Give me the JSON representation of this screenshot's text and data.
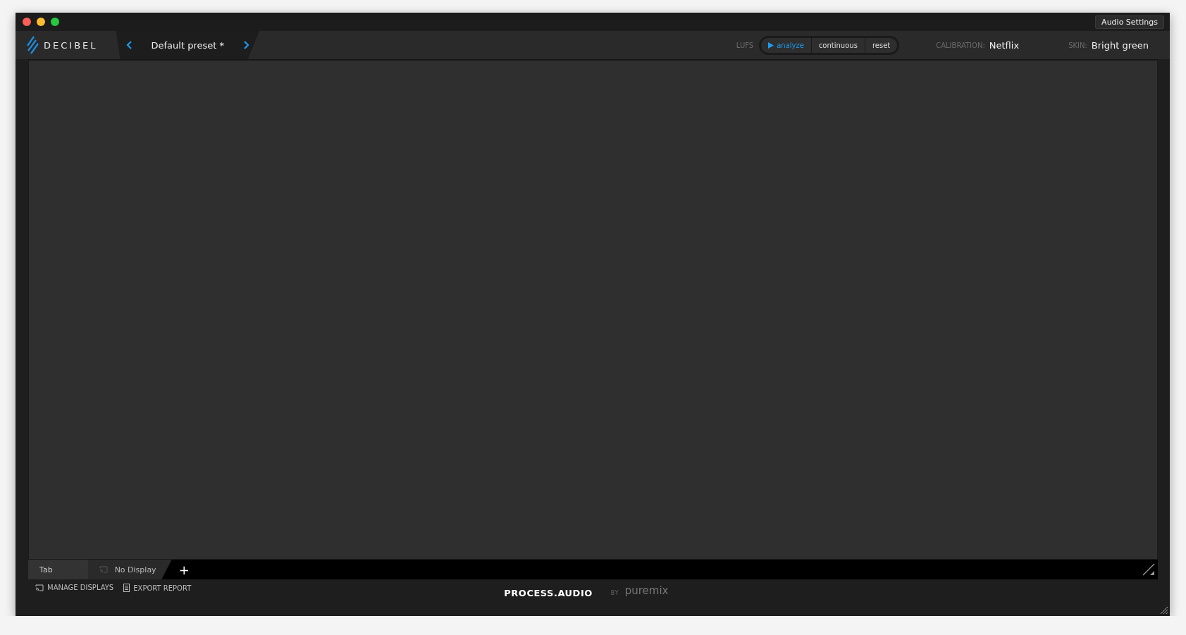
{
  "window": {
    "title_button": "Audio Settings"
  },
  "header": {
    "logo": "DECIBEL",
    "preset": "Default preset *",
    "lufs_label": "LUFS",
    "lufs_buttons": [
      {
        "label": "analyze",
        "selected": true
      },
      {
        "label": "continuous",
        "selected": false
      },
      {
        "label": "reset",
        "selected": false
      }
    ],
    "calibration_label": "CALIBRATION:",
    "calibration": "Netflix",
    "skin_label": "SKIN:",
    "skin": "Bright green"
  },
  "tabs": [
    {
      "label": "Tab",
      "selected": true,
      "kind": "plain"
    },
    {
      "label": "No Display",
      "selected": false,
      "kind": "display"
    }
  ],
  "add_tab": "+",
  "footer": {
    "actions": [
      {
        "label": "MANAGE DISPLAYS",
        "kind": "displays"
      },
      {
        "label": "EXPORT REPORT",
        "kind": "report"
      }
    ],
    "brand": "PROCESS.AUDIO",
    "by": "BY",
    "partner": "puremix"
  }
}
